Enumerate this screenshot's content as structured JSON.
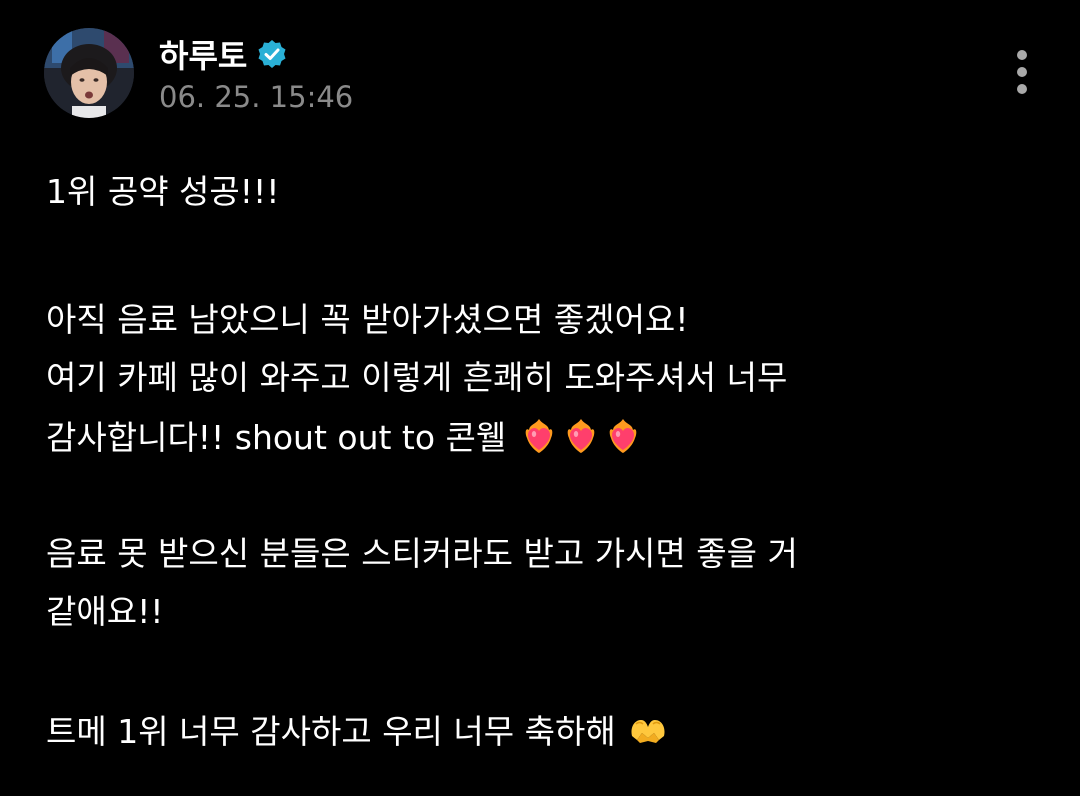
{
  "post": {
    "author": {
      "name": "하루토",
      "avatar_icon": "avatar-photo",
      "verified_icon": "verified-badge-icon",
      "verified_color": "#2ab0d6"
    },
    "timestamp": "06. 25. 15:46",
    "more_icon": "more-vertical-icon",
    "text": {
      "line1": "1위 공약 성공!!!",
      "line2": "아직 음료 남았으니 꼭 받아가셨으면 좋겠어요!",
      "line3": "여기 카페 많이 와주고 이렇게 흔쾌히 도와주셔서 너무",
      "line4": "감사합니다!! shout out to 콘웰",
      "line4_emojis": [
        "heart-on-fire-icon",
        "heart-on-fire-icon",
        "heart-on-fire-icon"
      ],
      "line5": "음료 못 받으신 분들은 스티커라도 받고 가시면 좋을 거",
      "line6": "같애요!!",
      "line7": "트메 1위 너무 감사하고 우리 너무 축하해",
      "line7_emoji": "heart-hands-icon"
    }
  },
  "colors": {
    "background": "#000000",
    "text": "#ffffff",
    "muted": "#8a8a8a"
  }
}
